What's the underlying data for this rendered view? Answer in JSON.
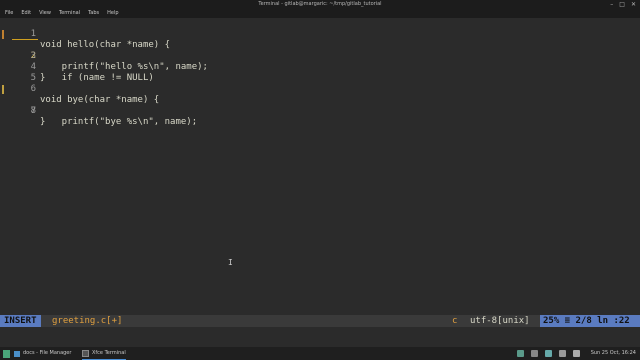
{
  "window": {
    "title": "Terminal - gitlab@margaric: ~/tmp/gitlab_tutorial",
    "controls": [
      "–",
      "□",
      "✕"
    ]
  },
  "menu": [
    "File",
    "Edit",
    "View",
    "Terminal",
    "Tabs",
    "Help"
  ],
  "editor": {
    "lines": [
      {
        "num": "1",
        "text": "void hello(char *name) {"
      },
      {
        "num": "2",
        "text": "    if (name != NULL)"
      },
      {
        "num": "3",
        "text": "    printf(\"hello %s\\n\", name);"
      },
      {
        "num": "4",
        "text": "}"
      },
      {
        "num": "5",
        "text": ""
      },
      {
        "num": "6",
        "text": "void bye(char *name) {"
      },
      {
        "num": "7",
        "text": "    printf(\"bye %s\\n\", name);"
      },
      {
        "num": "8",
        "text": "}"
      }
    ]
  },
  "status": {
    "mode": "INSERT",
    "file": "greeting.c[+]",
    "filetype": "c",
    "encoding": "utf-8[unix]",
    "position": "25% ≡ 2/8 ln :22"
  },
  "taskbar": {
    "items": [
      "docs - File Manager",
      "Xfce Terminal"
    ],
    "clock": "Sun 25 Oct, 16:24"
  },
  "colors": {
    "accent": "#5a7bc0",
    "keyword": "#e6d07a",
    "highlight": "#e0a040"
  }
}
